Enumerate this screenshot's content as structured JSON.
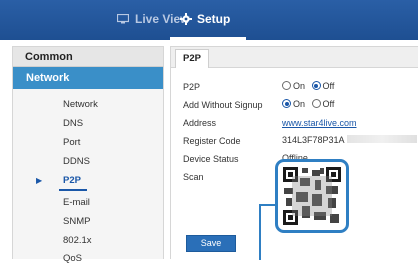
{
  "topbar": {
    "live_view_label": "Live View",
    "setup_label": "Setup",
    "live_view_icon": "monitor-icon",
    "setup_icon": "gear-icon"
  },
  "sidebar": {
    "common_label": "Common",
    "network_label": "Network",
    "items": [
      {
        "label": "Network",
        "active": false
      },
      {
        "label": "DNS",
        "active": false
      },
      {
        "label": "Port",
        "active": false
      },
      {
        "label": "DDNS",
        "active": false
      },
      {
        "label": "P2P",
        "active": true
      },
      {
        "label": "E-mail",
        "active": false
      },
      {
        "label": "SNMP",
        "active": false
      },
      {
        "label": "802.1x",
        "active": false
      },
      {
        "label": "QoS",
        "active": false
      }
    ]
  },
  "panel": {
    "tab_label": "P2P",
    "p2p": {
      "label": "P2P",
      "on_label": "On",
      "off_label": "Off",
      "selected": "Off"
    },
    "add_without_signup": {
      "label": "Add Without Signup",
      "on_label": "On",
      "off_label": "Off",
      "selected": "On"
    },
    "address": {
      "label": "Address",
      "value": "www.star4live.com"
    },
    "register_code": {
      "label": "Register Code",
      "value": "314L3F78P31A"
    },
    "device_status": {
      "label": "Device Status",
      "value": "Offline"
    },
    "scan": {
      "label": "Scan"
    },
    "save_label": "Save"
  },
  "colors": {
    "topbar": "#1e4f92",
    "accent": "#3a8fc8",
    "link": "#1a57a8",
    "qr_border": "#2f7fc3"
  }
}
